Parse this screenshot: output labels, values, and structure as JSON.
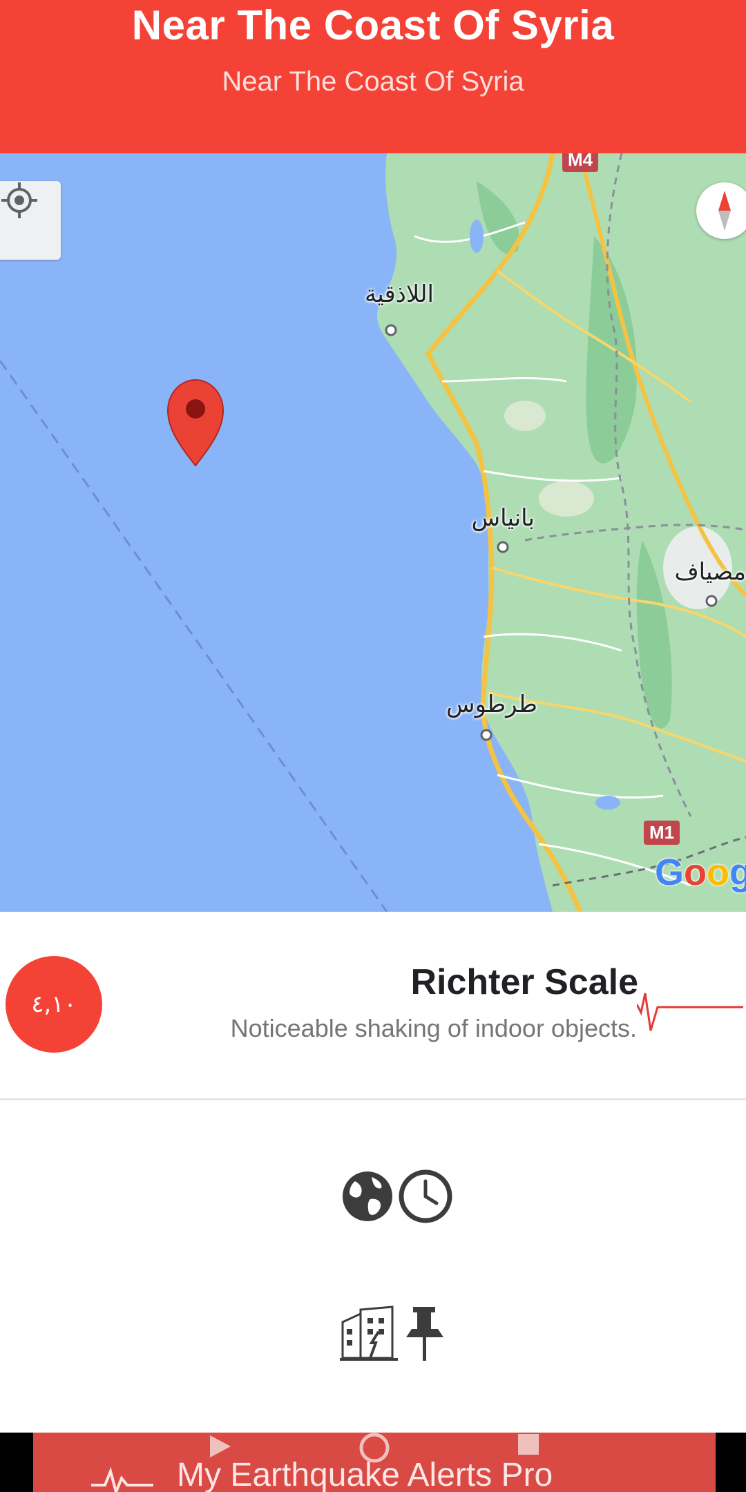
{
  "header": {
    "title": "Near The Coast Of Syria",
    "subtitle": "Near The Coast Of Syria"
  },
  "map": {
    "cities": [
      {
        "name": "اللاذقية"
      },
      {
        "name": "بانياس"
      },
      {
        "name": "مصياف"
      },
      {
        "name": "طرطوس"
      }
    ],
    "road_shields": [
      "M4",
      "M1"
    ],
    "attribution": "Google",
    "icons": [
      "my-location-icon",
      "compass-icon",
      "map-marker-icon"
    ]
  },
  "quake": {
    "magnitude": "٤,١٠",
    "scale_title": "Richter Scale",
    "scale_description": "Noticeable shaking of indoor objects."
  },
  "details": {
    "icons": [
      "globe-icon",
      "clock-icon",
      "damaged-building-icon",
      "pushpin-icon"
    ]
  },
  "banner": {
    "text": "My Earthquake Alerts Pro"
  },
  "colors": {
    "accent": "#f44336",
    "water": "#8ab4f8",
    "land": "#aedcb3",
    "road": "#f5c343"
  }
}
